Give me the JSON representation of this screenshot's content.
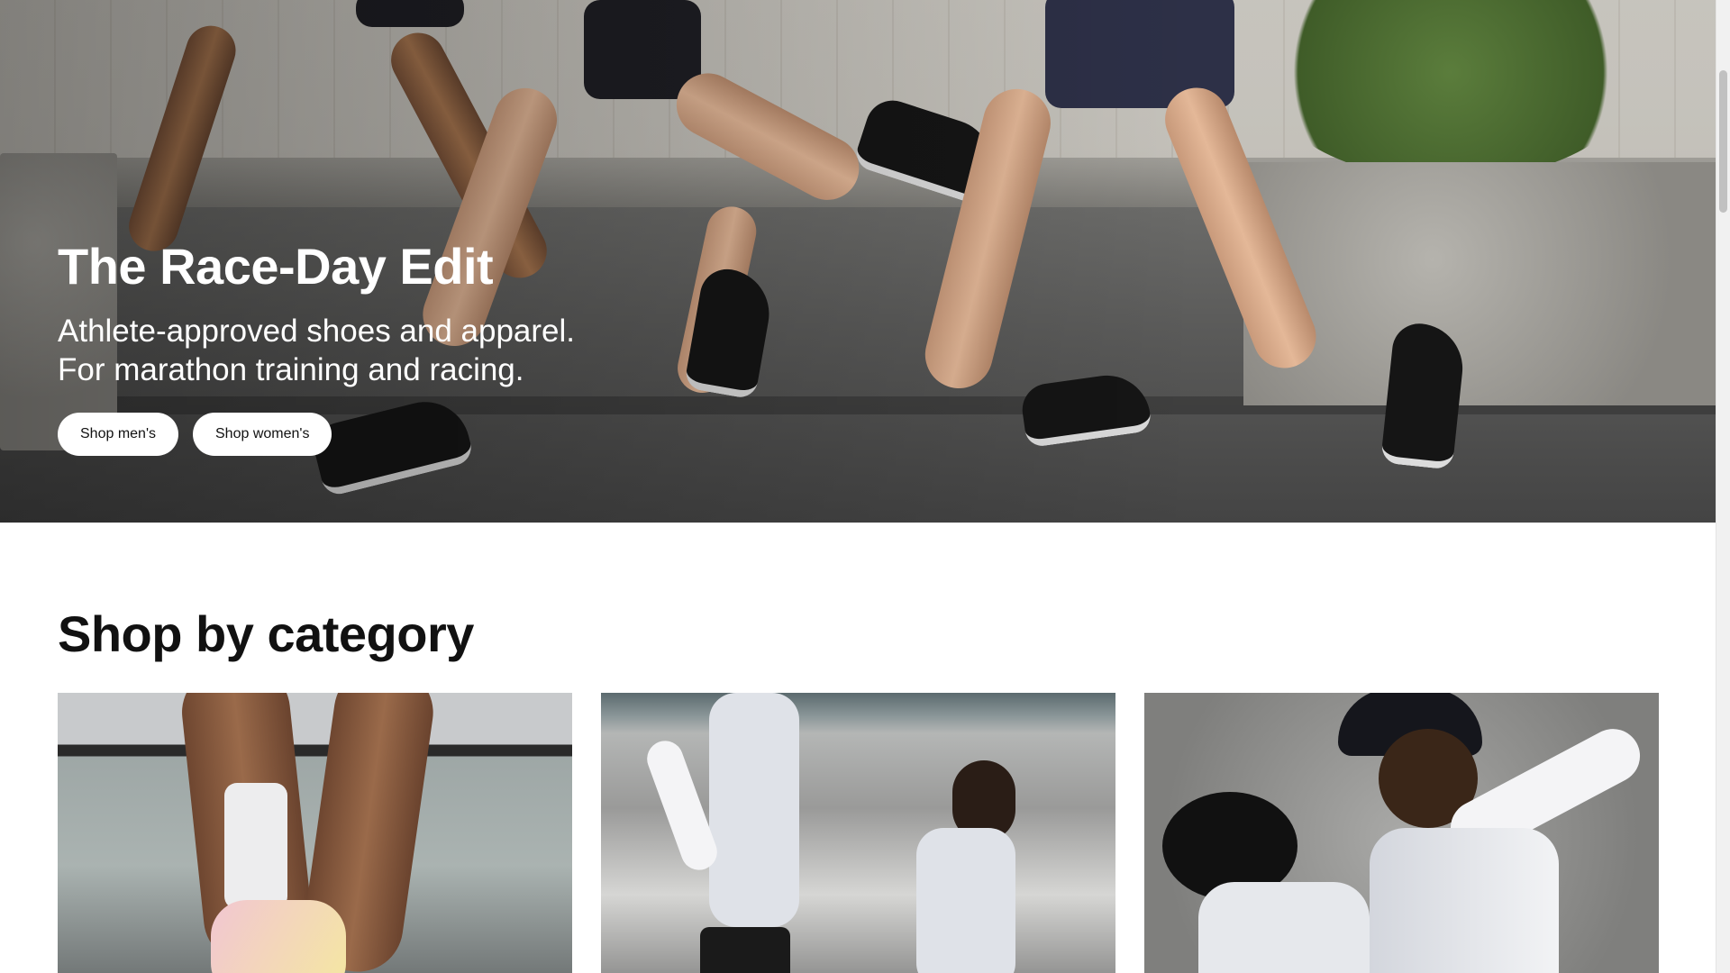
{
  "hero": {
    "title": "The Race-Day Edit",
    "subtitle_line1": "Athlete-approved shoes and apparel.",
    "subtitle_line2": "For marathon training and racing.",
    "buttons": [
      {
        "label": "Shop men's"
      },
      {
        "label": "Shop women's"
      }
    ]
  },
  "category": {
    "title": "Shop by category",
    "cards": [
      {
        "image": "runner-shoe-closeup-image"
      },
      {
        "image": "two-runners-image"
      },
      {
        "image": "runners-embrace-image"
      }
    ]
  }
}
